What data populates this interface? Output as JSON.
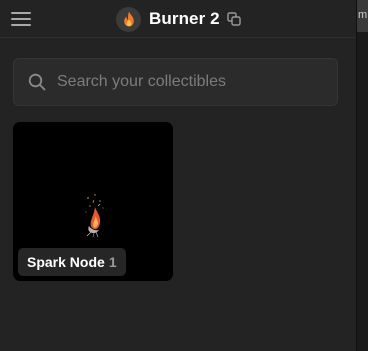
{
  "header": {
    "menu_icon": "hamburger-menu-icon",
    "avatar_icon": "flame-icon",
    "title": "Burner 2",
    "copy_icon": "copy-icon"
  },
  "search": {
    "placeholder": "Search your collectibles",
    "value": "",
    "icon": "search-icon"
  },
  "collectibles": [
    {
      "name": "Spark Node",
      "count": "1"
    }
  ],
  "right_panel": {
    "tab_text": "m"
  },
  "colors": {
    "background": "#232323",
    "search_bg": "#2b2b2b",
    "card_bg": "#000000",
    "text_primary": "#ffffff",
    "text_muted": "#7c7c7c",
    "flame": "#f07a2a"
  }
}
